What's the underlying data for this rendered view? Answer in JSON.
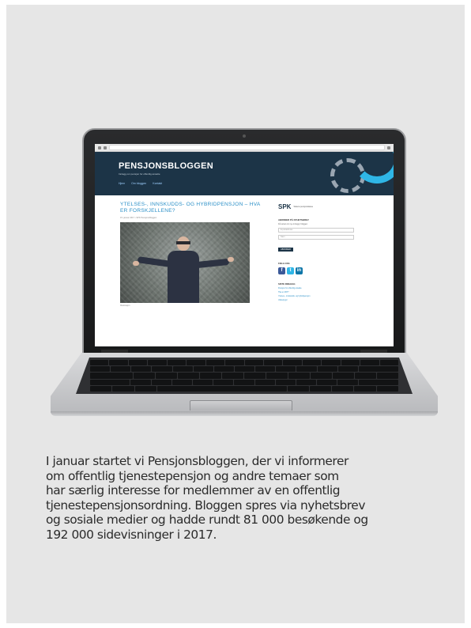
{
  "blog": {
    "site_title": "PENSJONSBLOGGEN",
    "site_subtitle": "Innlegg om pensjon for offentlig ansatte",
    "nav": [
      "Hjem",
      "Om bloggen",
      "Kontakt"
    ],
    "post_title": "YTELSES-, INNSKUDDS- OG HYBRIDPENSJON – HVA ER FORSKJELLENE?",
    "post_meta": "15. januar 2017 • SPK Pensjonsbloggen",
    "image_caption": "Illustrasjon",
    "sidebar": {
      "logo": "SPK",
      "logo_text": "Statens pensjonskasse",
      "subscribe_heading": "ABONNER PÅ NYHETSBREV",
      "subscribe_text": "Få varsel om nye innlegg i bloggen",
      "email_placeholder": "E-postadresse",
      "name_placeholder": "Navn",
      "subscribe_button": "ABONNER",
      "follow_heading": "FØLG OSS",
      "social": [
        {
          "icon": "facebook-icon",
          "glyph": "f",
          "color": "#3b5998"
        },
        {
          "icon": "twitter-icon",
          "glyph": "t",
          "color": "#2fb6e6"
        },
        {
          "icon": "linkedin-icon",
          "glyph": "in",
          "color": "#0e76a8"
        }
      ],
      "recent_heading": "SISTE INNLEGG",
      "recent_links": [
        "Pensjon for offentlig ansatte",
        "Hva er AFP?",
        "Ytelses-, innskudds- og hybridpensjon",
        "Uføretrygd"
      ]
    }
  },
  "paragraph": {
    "lines": [
      "I januar startet vi Pensjonsbloggen, der vi informerer",
      "om offentlig tjenestepensjon og andre temaer som",
      "har særlig interesse for medlemmer av en offentlig",
      "tjenestepensjonsordning. Bloggen spres via nyhetsbrev",
      "og sosiale medier og hadde rundt 81 000 besøkende og",
      "192 000 sidevisninger i 2017."
    ]
  },
  "colors": {
    "panel_background": "#e6e6e6",
    "header_navy": "#1c3447",
    "accent_blue": "#2fb6e6",
    "title_blue": "#2a8fc7"
  }
}
